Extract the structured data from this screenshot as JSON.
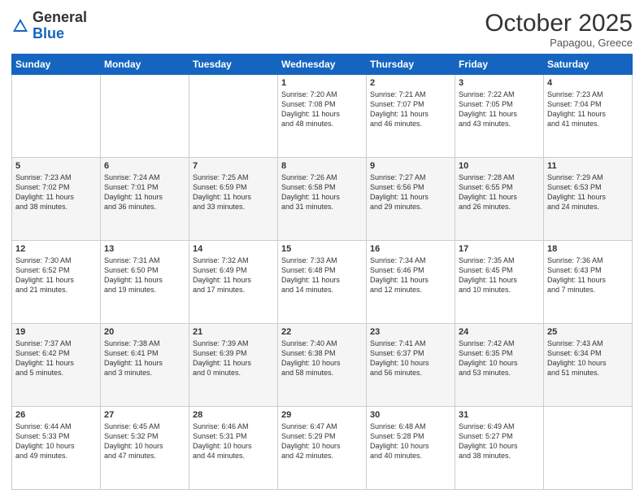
{
  "logo": {
    "general": "General",
    "blue": "Blue"
  },
  "header": {
    "month": "October 2025",
    "location": "Papagou, Greece"
  },
  "days_header": [
    "Sunday",
    "Monday",
    "Tuesday",
    "Wednesday",
    "Thursday",
    "Friday",
    "Saturday"
  ],
  "weeks": [
    [
      {
        "num": "",
        "content": ""
      },
      {
        "num": "",
        "content": ""
      },
      {
        "num": "",
        "content": ""
      },
      {
        "num": "1",
        "content": "Sunrise: 7:20 AM\nSunset: 7:08 PM\nDaylight: 11 hours\nand 48 minutes."
      },
      {
        "num": "2",
        "content": "Sunrise: 7:21 AM\nSunset: 7:07 PM\nDaylight: 11 hours\nand 46 minutes."
      },
      {
        "num": "3",
        "content": "Sunrise: 7:22 AM\nSunset: 7:05 PM\nDaylight: 11 hours\nand 43 minutes."
      },
      {
        "num": "4",
        "content": "Sunrise: 7:23 AM\nSunset: 7:04 PM\nDaylight: 11 hours\nand 41 minutes."
      }
    ],
    [
      {
        "num": "5",
        "content": "Sunrise: 7:23 AM\nSunset: 7:02 PM\nDaylight: 11 hours\nand 38 minutes."
      },
      {
        "num": "6",
        "content": "Sunrise: 7:24 AM\nSunset: 7:01 PM\nDaylight: 11 hours\nand 36 minutes."
      },
      {
        "num": "7",
        "content": "Sunrise: 7:25 AM\nSunset: 6:59 PM\nDaylight: 11 hours\nand 33 minutes."
      },
      {
        "num": "8",
        "content": "Sunrise: 7:26 AM\nSunset: 6:58 PM\nDaylight: 11 hours\nand 31 minutes."
      },
      {
        "num": "9",
        "content": "Sunrise: 7:27 AM\nSunset: 6:56 PM\nDaylight: 11 hours\nand 29 minutes."
      },
      {
        "num": "10",
        "content": "Sunrise: 7:28 AM\nSunset: 6:55 PM\nDaylight: 11 hours\nand 26 minutes."
      },
      {
        "num": "11",
        "content": "Sunrise: 7:29 AM\nSunset: 6:53 PM\nDaylight: 11 hours\nand 24 minutes."
      }
    ],
    [
      {
        "num": "12",
        "content": "Sunrise: 7:30 AM\nSunset: 6:52 PM\nDaylight: 11 hours\nand 21 minutes."
      },
      {
        "num": "13",
        "content": "Sunrise: 7:31 AM\nSunset: 6:50 PM\nDaylight: 11 hours\nand 19 minutes."
      },
      {
        "num": "14",
        "content": "Sunrise: 7:32 AM\nSunset: 6:49 PM\nDaylight: 11 hours\nand 17 minutes."
      },
      {
        "num": "15",
        "content": "Sunrise: 7:33 AM\nSunset: 6:48 PM\nDaylight: 11 hours\nand 14 minutes."
      },
      {
        "num": "16",
        "content": "Sunrise: 7:34 AM\nSunset: 6:46 PM\nDaylight: 11 hours\nand 12 minutes."
      },
      {
        "num": "17",
        "content": "Sunrise: 7:35 AM\nSunset: 6:45 PM\nDaylight: 11 hours\nand 10 minutes."
      },
      {
        "num": "18",
        "content": "Sunrise: 7:36 AM\nSunset: 6:43 PM\nDaylight: 11 hours\nand 7 minutes."
      }
    ],
    [
      {
        "num": "19",
        "content": "Sunrise: 7:37 AM\nSunset: 6:42 PM\nDaylight: 11 hours\nand 5 minutes."
      },
      {
        "num": "20",
        "content": "Sunrise: 7:38 AM\nSunset: 6:41 PM\nDaylight: 11 hours\nand 3 minutes."
      },
      {
        "num": "21",
        "content": "Sunrise: 7:39 AM\nSunset: 6:39 PM\nDaylight: 11 hours\nand 0 minutes."
      },
      {
        "num": "22",
        "content": "Sunrise: 7:40 AM\nSunset: 6:38 PM\nDaylight: 10 hours\nand 58 minutes."
      },
      {
        "num": "23",
        "content": "Sunrise: 7:41 AM\nSunset: 6:37 PM\nDaylight: 10 hours\nand 56 minutes."
      },
      {
        "num": "24",
        "content": "Sunrise: 7:42 AM\nSunset: 6:35 PM\nDaylight: 10 hours\nand 53 minutes."
      },
      {
        "num": "25",
        "content": "Sunrise: 7:43 AM\nSunset: 6:34 PM\nDaylight: 10 hours\nand 51 minutes."
      }
    ],
    [
      {
        "num": "26",
        "content": "Sunrise: 6:44 AM\nSunset: 5:33 PM\nDaylight: 10 hours\nand 49 minutes."
      },
      {
        "num": "27",
        "content": "Sunrise: 6:45 AM\nSunset: 5:32 PM\nDaylight: 10 hours\nand 47 minutes."
      },
      {
        "num": "28",
        "content": "Sunrise: 6:46 AM\nSunset: 5:31 PM\nDaylight: 10 hours\nand 44 minutes."
      },
      {
        "num": "29",
        "content": "Sunrise: 6:47 AM\nSunset: 5:29 PM\nDaylight: 10 hours\nand 42 minutes."
      },
      {
        "num": "30",
        "content": "Sunrise: 6:48 AM\nSunset: 5:28 PM\nDaylight: 10 hours\nand 40 minutes."
      },
      {
        "num": "31",
        "content": "Sunrise: 6:49 AM\nSunset: 5:27 PM\nDaylight: 10 hours\nand 38 minutes."
      },
      {
        "num": "",
        "content": ""
      }
    ]
  ]
}
